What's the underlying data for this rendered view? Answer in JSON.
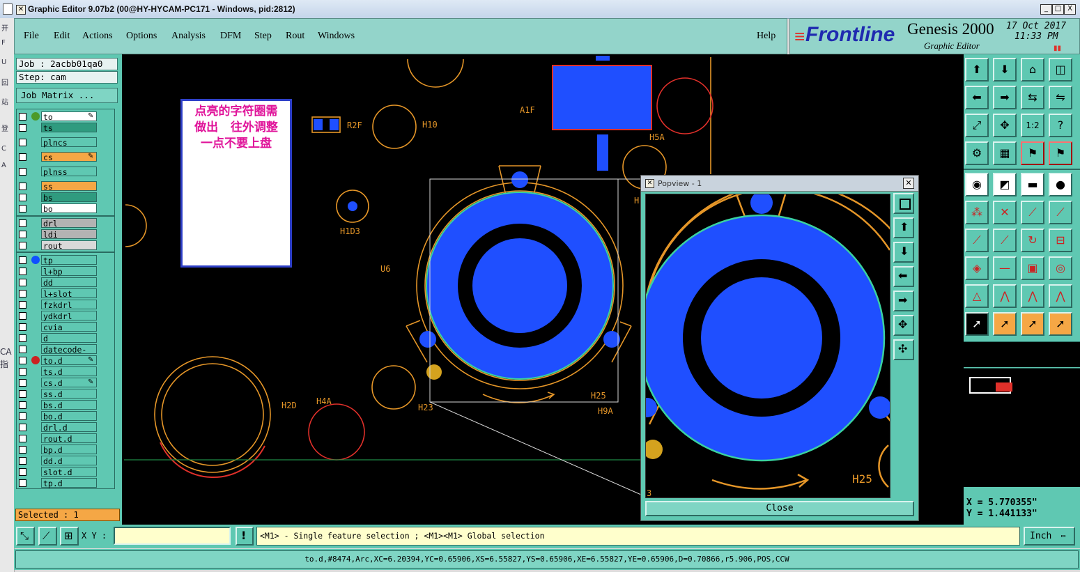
{
  "window": {
    "title": "Graphic Editor 9.07b2 (00@HY-HYCAM-PC171 - Windows, pid:2812)",
    "controls": [
      "_",
      "□",
      "X"
    ]
  },
  "left_strip_chars": [
    "开",
    "F",
    "U",
    "回",
    "站",
    "登",
    "C",
    "A",
    "CA",
    "指"
  ],
  "menu": {
    "items": [
      "File",
      "Edit",
      "Actions",
      "Options",
      "Analysis",
      "DFM",
      "Step",
      "Rout",
      "Windows"
    ],
    "help": "Help"
  },
  "brand": {
    "logo": "Frontline",
    "product": "Genesis 2000",
    "subtitle": "Graphic Editor",
    "date": "17 Oct 2017",
    "time": "11:33 PM"
  },
  "job": {
    "job_label": "Job : 2acbb01qa0",
    "step_label": "Step: cam",
    "matrix_button": "Job Matrix ..."
  },
  "layers": [
    {
      "name": "to",
      "color": "#ffffff",
      "dot": "#4c9a2a",
      "pen": true
    },
    {
      "name": "ts",
      "color": "#2f9b7f",
      "dot": "",
      "pen": false
    },
    {
      "name": "plncs",
      "color": "#5fc8b2",
      "dot": "",
      "pen": false
    },
    {
      "name": "cs",
      "color": "#f5a745",
      "dot": "",
      "pen": true
    },
    {
      "name": "plnss",
      "color": "#5fc8b2",
      "dot": "",
      "pen": false
    },
    {
      "name": "ss",
      "color": "#f5a745",
      "dot": "",
      "pen": false
    },
    {
      "name": "bs",
      "color": "#2f9b7f",
      "dot": "",
      "pen": false
    },
    {
      "name": "bo",
      "color": "#ffffff",
      "dot": "",
      "pen": false
    },
    {
      "name": "drl",
      "color": "#b3b3b3",
      "dot": "",
      "pen": false
    },
    {
      "name": "ldi",
      "color": "#b3b3b3",
      "dot": "",
      "pen": false
    },
    {
      "name": "rout",
      "color": "#d9d9d9",
      "dot": "",
      "pen": false
    },
    {
      "name": "tp",
      "color": "#5fc8b2",
      "dot": "#1050ff",
      "pen": false
    },
    {
      "name": "l+bp",
      "color": "#5fc8b2",
      "dot": "",
      "pen": false
    },
    {
      "name": "dd",
      "color": "#5fc8b2",
      "dot": "",
      "pen": false
    },
    {
      "name": "l+slot",
      "color": "#5fc8b2",
      "dot": "",
      "pen": false
    },
    {
      "name": "fzkdrl",
      "color": "#5fc8b2",
      "dot": "",
      "pen": false
    },
    {
      "name": "ydkdrl",
      "color": "#5fc8b2",
      "dot": "",
      "pen": false
    },
    {
      "name": "cvia",
      "color": "#5fc8b2",
      "dot": "",
      "pen": false
    },
    {
      "name": "d",
      "color": "#5fc8b2",
      "dot": "",
      "pen": false
    },
    {
      "name": "datecode-bo",
      "color": "#5fc8b2",
      "dot": "",
      "pen": false
    },
    {
      "name": "to.d",
      "color": "#5fc8b2",
      "dot": "#cc2222",
      "pen": true
    },
    {
      "name": "ts.d",
      "color": "#5fc8b2",
      "dot": "",
      "pen": false
    },
    {
      "name": "cs.d",
      "color": "#5fc8b2",
      "dot": "",
      "pen": true
    },
    {
      "name": "ss.d",
      "color": "#5fc8b2",
      "dot": "",
      "pen": false
    },
    {
      "name": "bs.d",
      "color": "#5fc8b2",
      "dot": "",
      "pen": false
    },
    {
      "name": "bo.d",
      "color": "#5fc8b2",
      "dot": "",
      "pen": false
    },
    {
      "name": "drl.d",
      "color": "#5fc8b2",
      "dot": "",
      "pen": false
    },
    {
      "name": "rout.d",
      "color": "#5fc8b2",
      "dot": "",
      "pen": false
    },
    {
      "name": "bp.d",
      "color": "#5fc8b2",
      "dot": "",
      "pen": false
    },
    {
      "name": "dd.d",
      "color": "#5fc8b2",
      "dot": "",
      "pen": false
    },
    {
      "name": "slot.d",
      "color": "#5fc8b2",
      "dot": "",
      "pen": false
    },
    {
      "name": "tp.d",
      "color": "#5fc8b2",
      "dot": "",
      "pen": false
    }
  ],
  "selected": "Selected : 1",
  "note": {
    "line1": "点亮的字符圈需",
    "line2": "做出   往外调整",
    "line3": "一点不要上盘"
  },
  "canvas_labels": {
    "r2f": "R2F",
    "h10": "H10",
    "a1f": "A1F",
    "h5a": "H5A",
    "h103": "H1D3",
    "u6": "U6",
    "h2d": "H2D",
    "h4a": "H4A",
    "h23": "H23",
    "h25": "H25",
    "h9a": "H9A",
    "h": "H"
  },
  "popview": {
    "title": "Popview - 1",
    "close": "Close",
    "label_h25": "H25",
    "label_3": "3"
  },
  "coords": {
    "x": "X = 5.770355\"",
    "y": "Y = 1.441133\""
  },
  "bottom": {
    "xy_label": "X Y :",
    "xy_value": "",
    "hint": "<M1> - Single feature selection ; <M1><M1> Global selection",
    "unit": "Inch",
    "warn": "!"
  },
  "status": "to.d,#8474,Arc,XC=6.20394,YC=0.65906,XS=6.55827,YS=0.65906,XE=6.55827,YE=0.65906,D=0.70866,r5.906,POS,CCW",
  "colors": {
    "teal": "#5fc8b2",
    "menu": "#93d4ca",
    "pad_blue": "#1f4fff",
    "silk_orange": "#e59628",
    "note_text": "#e0149a"
  }
}
